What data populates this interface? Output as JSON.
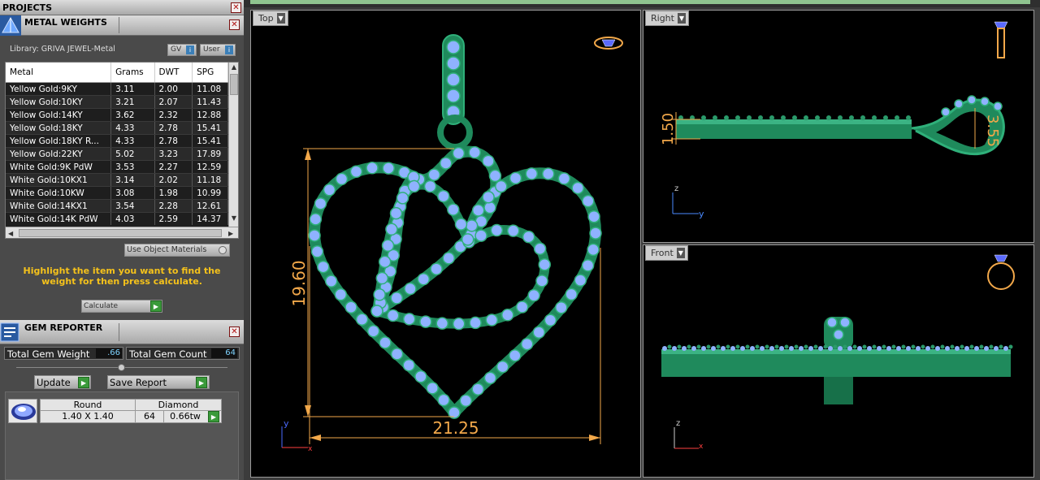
{
  "projects": {
    "title": "PROJECTS",
    "close": "✕"
  },
  "metal_weights": {
    "title": "METAL WEIGHTS",
    "close": "✕",
    "library_label": "Library: GRIVA JEWEL-Metal",
    "gv_label": "GV",
    "user_label": "User",
    "columns": [
      "Metal",
      "Grams",
      "DWT",
      "SPG"
    ],
    "rows": [
      [
        "Yellow Gold:9KY",
        "3.11",
        "2.00",
        "11.08"
      ],
      [
        "Yellow Gold:10KY",
        "3.21",
        "2.07",
        "11.43"
      ],
      [
        "Yellow Gold:14KY",
        "3.62",
        "2.32",
        "12.88"
      ],
      [
        "Yellow Gold:18KY",
        "4.33",
        "2.78",
        "15.41"
      ],
      [
        "Yellow Gold:18KY R...",
        "4.33",
        "2.78",
        "15.41"
      ],
      [
        "Yellow Gold:22KY",
        "5.02",
        "3.23",
        "17.89"
      ],
      [
        "White Gold:9K PdW",
        "3.53",
        "2.27",
        "12.59"
      ],
      [
        "White Gold:10KX1",
        "3.14",
        "2.02",
        "11.18"
      ],
      [
        "White Gold:10KW",
        "3.08",
        "1.98",
        "10.99"
      ],
      [
        "White Gold:14KX1",
        "3.54",
        "2.28",
        "12.61"
      ],
      [
        "White Gold:14K PdW",
        "4.03",
        "2.59",
        "14.37"
      ]
    ],
    "use_object_materials": "Use Object Materials",
    "hint": "Highlight the item you want to find the weight for then press calculate.",
    "calculate_label": "Calculate"
  },
  "gem_reporter": {
    "title": "GEM REPORTER",
    "close": "✕",
    "total_weight_label": "Total Gem Weight",
    "total_weight_value": ".66",
    "total_count_label": "Total Gem Count",
    "total_count_value": "64",
    "update_label": "Update",
    "save_report_label": "Save Report",
    "gem": {
      "shape": "Round",
      "type": "Diamond",
      "size": "1.40 X 1.40",
      "count": "64",
      "weight": "0.66tw"
    }
  },
  "viewports": {
    "top": {
      "label": "Top",
      "dim_height": "19.60",
      "dim_width": "21.25",
      "axis_y": "y",
      "axis_x": "x"
    },
    "right": {
      "label": "Right",
      "dim_thickness": "1.50",
      "dim_bail": "3.55",
      "axis_z": "z",
      "axis_y": "y"
    },
    "front": {
      "label": "Front",
      "axis_z": "z",
      "axis_x": "x"
    }
  },
  "colors": {
    "metal": "#1f8a5c",
    "gem": "#8fb2ff",
    "dimension": "#f2a84a",
    "hint_text": "#f5c21b"
  }
}
